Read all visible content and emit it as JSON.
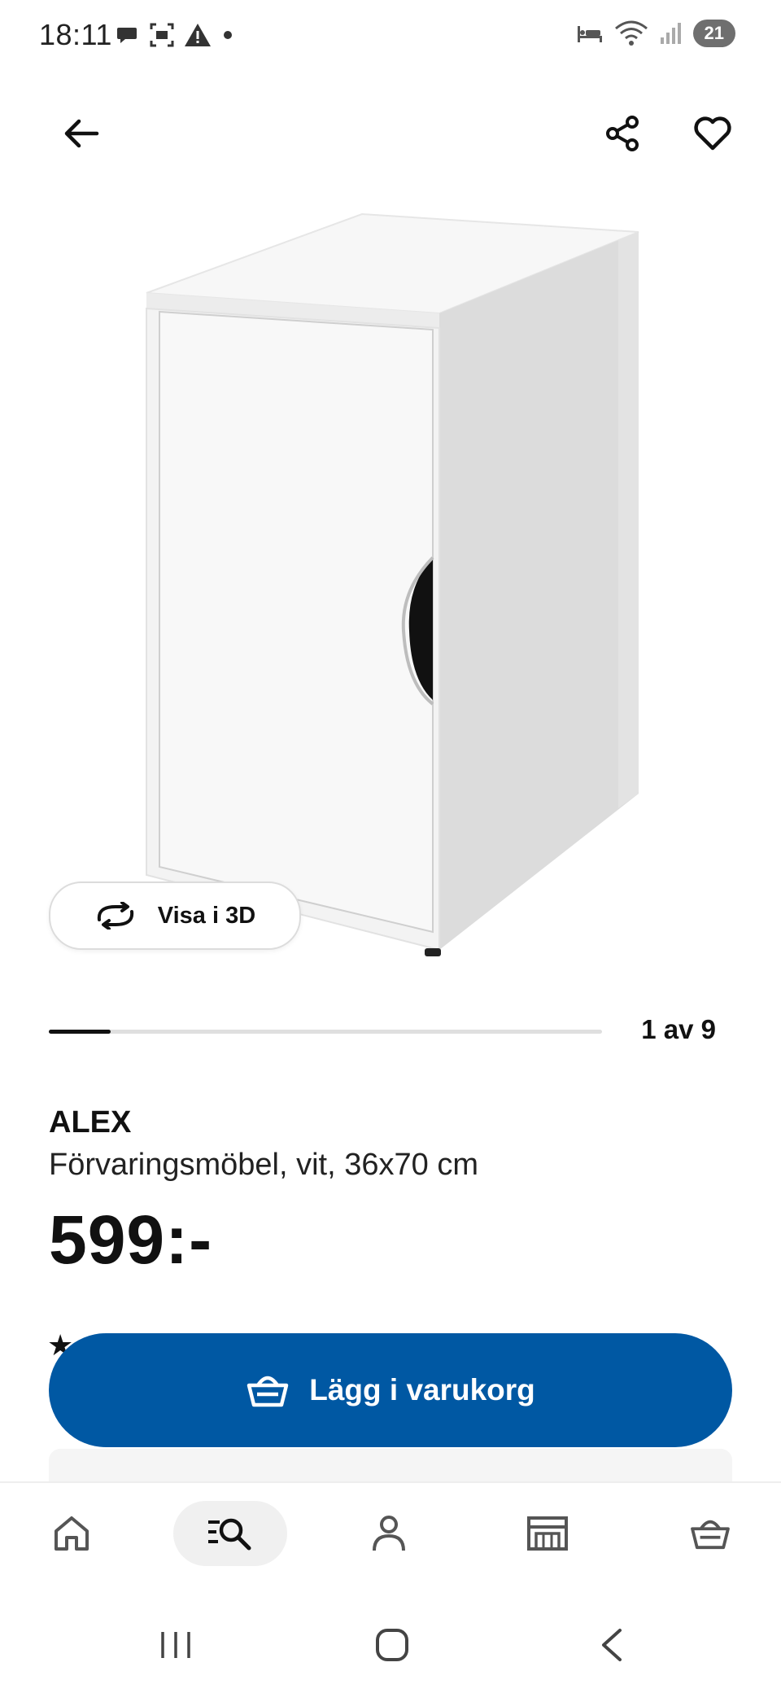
{
  "status_bar": {
    "time": "18:11",
    "battery": "21",
    "left_icons": [
      "chat-icon",
      "screenshot-icon",
      "warning-icon",
      "dot-icon"
    ],
    "right_icons": [
      "bed-icon",
      "wifi-icon",
      "signal-icon"
    ]
  },
  "top_bar": {
    "back_icon": "arrow-left-icon",
    "share_icon": "share-icon",
    "favorite_icon": "heart-icon"
  },
  "gallery": {
    "view_3d_label": "Visa i 3D",
    "pager_label": "1 av 9",
    "current_index": 1,
    "total": 9
  },
  "product": {
    "name": "ALEX",
    "description": "Förvaringsmöbel, vit, 36x70 cm",
    "price": "599:-"
  },
  "cart": {
    "add_label": "Lägg i varukorg"
  },
  "bottom_nav": {
    "items": [
      {
        "name": "home",
        "icon": "home-icon"
      },
      {
        "name": "search",
        "icon": "search-list-icon",
        "active": true
      },
      {
        "name": "profile",
        "icon": "person-icon"
      },
      {
        "name": "store",
        "icon": "store-icon"
      },
      {
        "name": "cart",
        "icon": "basket-icon"
      }
    ]
  },
  "colors": {
    "accent": "#0058a3",
    "text": "#111111",
    "nav_active_bg": "#f0f0f0"
  }
}
